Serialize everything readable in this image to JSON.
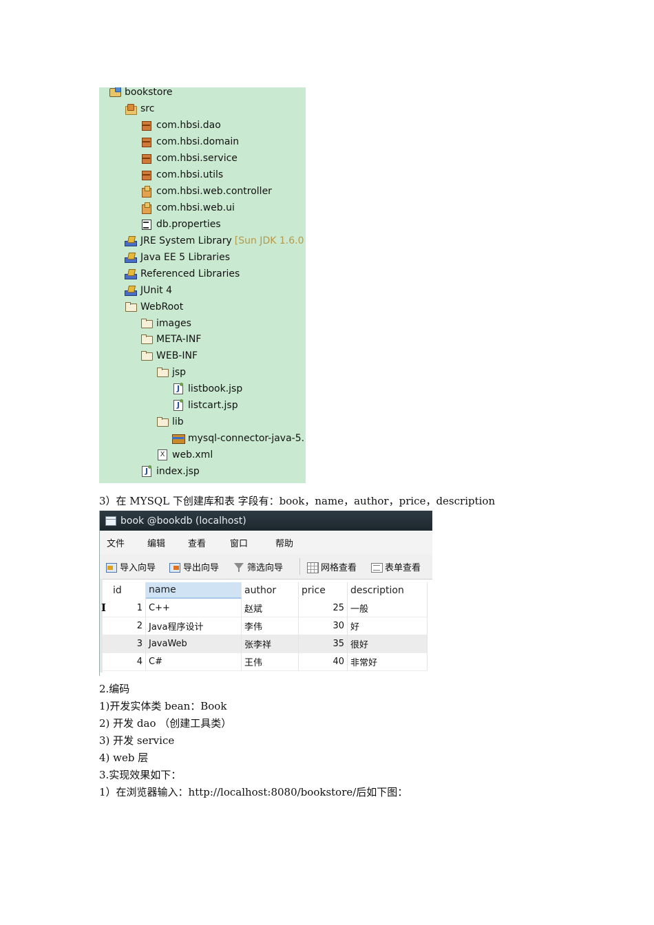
{
  "tree": {
    "items": [
      {
        "label": "bookstore",
        "icon": "project-icon"
      },
      {
        "label": "src",
        "icon": "source-folder-icon"
      },
      {
        "label": "com.hbsi.dao",
        "icon": "package-icon"
      },
      {
        "label": "com.hbsi.domain",
        "icon": "package-icon"
      },
      {
        "label": "com.hbsi.service",
        "icon": "package-icon"
      },
      {
        "label": "com.hbsi.utils",
        "icon": "package-icon"
      },
      {
        "label": "com.hbsi.web.controller",
        "icon": "package-icon"
      },
      {
        "label": "com.hbsi.web.ui",
        "icon": "package-icon"
      },
      {
        "label": "db.properties",
        "icon": "properties-file-icon"
      },
      {
        "label": "JRE System Library",
        "hint": "[Sun JDK 1.6.0",
        "icon": "library-icon"
      },
      {
        "label": "Java EE 5 Libraries",
        "icon": "library-icon"
      },
      {
        "label": "Referenced Libraries",
        "icon": "library-icon"
      },
      {
        "label": "JUnit 4",
        "icon": "library-icon"
      },
      {
        "label": "WebRoot",
        "icon": "folder-icon"
      },
      {
        "label": "images",
        "icon": "folder-icon"
      },
      {
        "label": "META-INF",
        "icon": "folder-icon"
      },
      {
        "label": "WEB-INF",
        "icon": "folder-icon"
      },
      {
        "label": "jsp",
        "icon": "folder-icon"
      },
      {
        "label": "listbook.jsp",
        "icon": "jsp-file-icon"
      },
      {
        "label": "listcart.jsp",
        "icon": "jsp-file-icon"
      },
      {
        "label": "lib",
        "icon": "folder-icon"
      },
      {
        "label": "mysql-connector-java-5.",
        "icon": "jar-icon"
      },
      {
        "label": "web.xml",
        "icon": "xml-file-icon"
      },
      {
        "label": "index.jsp",
        "icon": "jsp-file-icon"
      }
    ]
  },
  "doc": {
    "step3": "3）在 MYSQL 下创建库和表  字段有：book，name，author，price，description",
    "coding": "2.编码",
    "c1": "1)开发实体类 bean：Book",
    "c2": "2)  开发 dao      （创建工具类）",
    "c3": "3)    开发 service",
    "c4": "4)    web 层",
    "result": "3.实现效果如下：",
    "r1": "1）在浏览器输入：http://localhost:8080/bookstore/后如下图："
  },
  "window": {
    "title": "book @bookdb (localhost)",
    "menu": [
      "文件",
      "编辑",
      "查看",
      "窗口",
      "帮助"
    ],
    "toolbar": {
      "import": "导入向导",
      "export": "导出向导",
      "filter": "筛选向导",
      "grid_view": "网格查看",
      "form_view": "表单查看"
    },
    "columns": [
      "id",
      "name",
      "author",
      "price",
      "description"
    ],
    "rows": [
      {
        "id": "1",
        "name": "C++",
        "author": "赵斌",
        "price": "25",
        "description": "一般"
      },
      {
        "id": "2",
        "name": "Java程序设计",
        "author": "李伟",
        "price": "30",
        "description": "好"
      },
      {
        "id": "3",
        "name": "JavaWeb",
        "author": "张李祥",
        "price": "35",
        "description": "很好"
      },
      {
        "id": "4",
        "name": "C#",
        "author": "王伟",
        "price": "40",
        "description": "非常好"
      }
    ],
    "row_marker": "I"
  }
}
